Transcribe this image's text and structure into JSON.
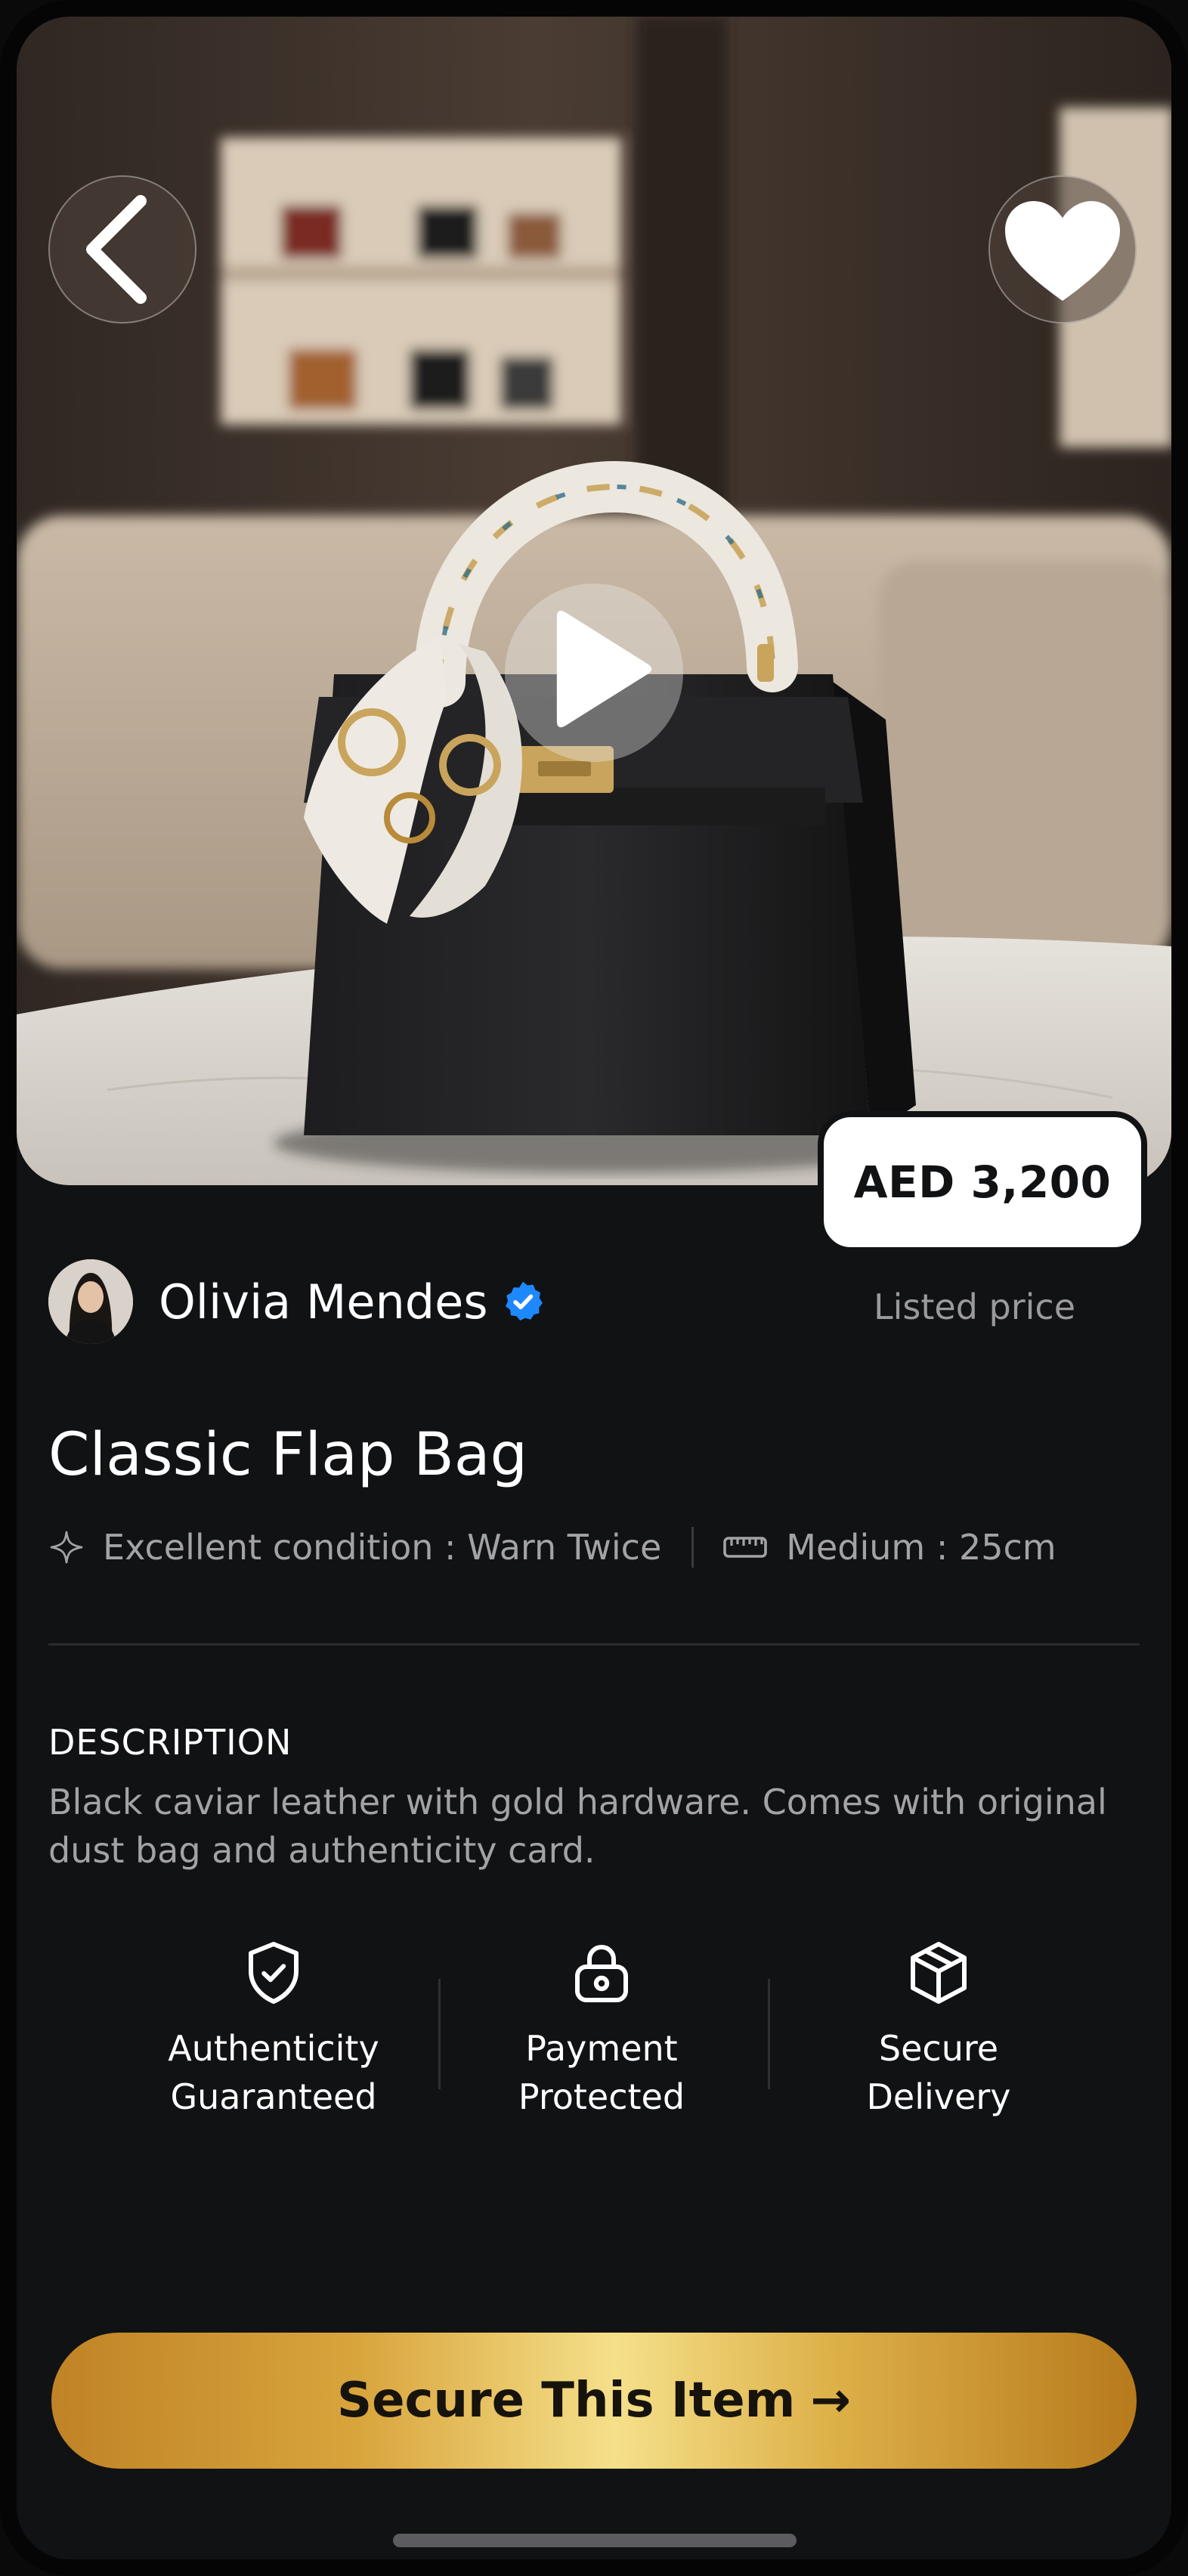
{
  "hero": {
    "back_icon": "chevron-left-icon",
    "favorite_icon": "heart-icon",
    "play_icon": "play-icon"
  },
  "product": {
    "price": "AED 3,200",
    "price_label": "Listed price",
    "title": "Classic Flap Bag",
    "condition_icon": "sparkle-icon",
    "condition": "Excellent condition : Warn Twice",
    "size_icon": "ruler-icon",
    "size": "Medium : 25cm"
  },
  "seller": {
    "name": "Olivia Mendes",
    "verified": true,
    "verified_color": "#1e88ff"
  },
  "description": {
    "heading": "DESCRIPTION",
    "text": "Black caviar leather with gold hardware. Comes with original dust bag and authenticity card."
  },
  "features": [
    {
      "icon": "shield-check-icon",
      "label": "Authenticity\nGuaranteed"
    },
    {
      "icon": "lock-icon",
      "label": "Payment\nProtected"
    },
    {
      "icon": "box-icon",
      "label": "Secure\nDelivery"
    }
  ],
  "cta": {
    "label": "Secure This Item",
    "arrow": "→"
  },
  "colors": {
    "background": "#111214",
    "gold_light": "#f5e08a",
    "gold_dark": "#b77a1c",
    "muted_text": "#a3a3a7"
  }
}
